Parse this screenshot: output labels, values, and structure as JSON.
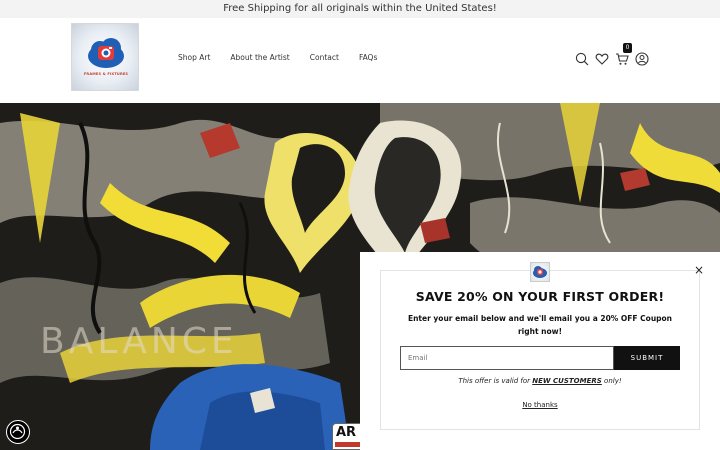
{
  "announcement": "Free Shipping for all originals within the United States!",
  "logo": {
    "text": "FRAMES & FIXTURES"
  },
  "nav": {
    "items": [
      "Shop Art",
      "About the Artist",
      "Contact",
      "FAQs"
    ]
  },
  "header_icons": {
    "search": "search-icon",
    "wishlist": "heart-icon",
    "cart": "cart-icon",
    "cart_count": "0",
    "account": "account-icon"
  },
  "badge": {
    "text": "AR"
  },
  "popup": {
    "title": "SAVE 20% ON YOUR FIRST ORDER!",
    "description": "Enter your email below and we'll email you a 20% OFF Coupon right now!",
    "email_placeholder": "Email",
    "submit_label": "SUBMIT",
    "offer_prefix": "This offer is valid for ",
    "offer_highlight": "NEW CUSTOMERS",
    "offer_suffix": " only!",
    "no_thanks": "No thanks",
    "close": "×"
  }
}
